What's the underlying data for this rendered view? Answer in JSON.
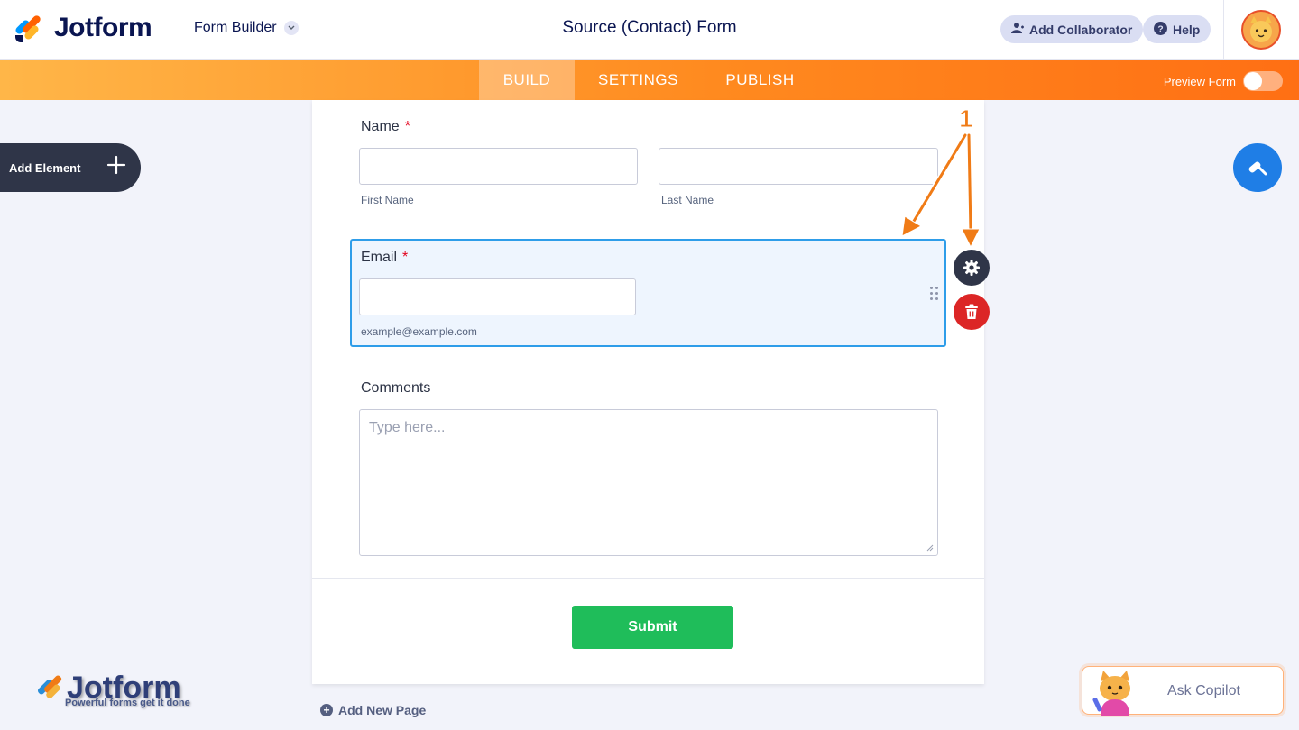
{
  "header": {
    "brand": "Jotform",
    "builder_menu": "Form Builder",
    "form_title": "Source (Contact) Form",
    "add_collaborator": "Add Collaborator",
    "help": "Help"
  },
  "nav": {
    "tabs": [
      {
        "label": "BUILD",
        "active": true
      },
      {
        "label": "SETTINGS",
        "active": false
      },
      {
        "label": "PUBLISH",
        "active": false
      }
    ],
    "preview_label": "Preview Form",
    "preview_on": false
  },
  "sidebar": {
    "add_element": "Add Element"
  },
  "form": {
    "name": {
      "label": "Name",
      "required_mark": "*",
      "first_sublabel": "First Name",
      "last_sublabel": "Last Name"
    },
    "email": {
      "label": "Email",
      "required_mark": "*",
      "sublabel": "example@example.com"
    },
    "comments": {
      "label": "Comments",
      "placeholder": "Type here..."
    },
    "submit": "Submit"
  },
  "annotation": {
    "number": "1"
  },
  "footer": {
    "add_new_page": "Add New Page",
    "watermark_name": "Jotform",
    "watermark_tagline": "Powerful forms get it done",
    "copilot": "Ask Copilot"
  },
  "colors": {
    "accent_orange": "#ff8a1f",
    "selection_blue": "#2e9de9",
    "submit_green": "#1fbd5a",
    "delete_red": "#dc2626",
    "navy": "#0a1551"
  },
  "icons": [
    "jotform-logo-icon",
    "chevron-down-icon",
    "add-user-icon",
    "help-icon",
    "avatar-icon",
    "plus-icon",
    "paint-roller-icon",
    "gear-icon",
    "trash-icon",
    "drag-handle-icon",
    "resize-grip-icon",
    "add-circle-icon",
    "copilot-mascot-icon"
  ]
}
